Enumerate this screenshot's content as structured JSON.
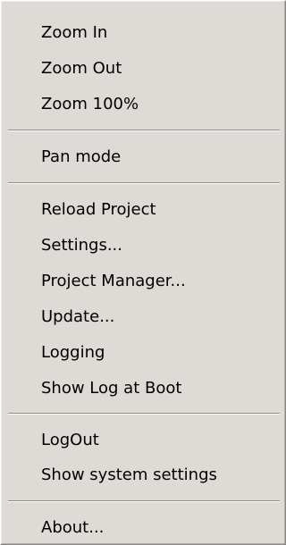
{
  "menu": {
    "items": [
      {
        "label": "Zoom In"
      },
      {
        "label": "Zoom Out"
      },
      {
        "label": "Zoom 100%"
      },
      {
        "label": "Pan mode"
      },
      {
        "label": "Reload Project"
      },
      {
        "label": "Settings..."
      },
      {
        "label": "Project Manager..."
      },
      {
        "label": "Update..."
      },
      {
        "label": "Logging"
      },
      {
        "label": "Show Log at Boot"
      },
      {
        "label": "LogOut"
      },
      {
        "label": "Show system settings"
      },
      {
        "label": "About..."
      }
    ]
  }
}
